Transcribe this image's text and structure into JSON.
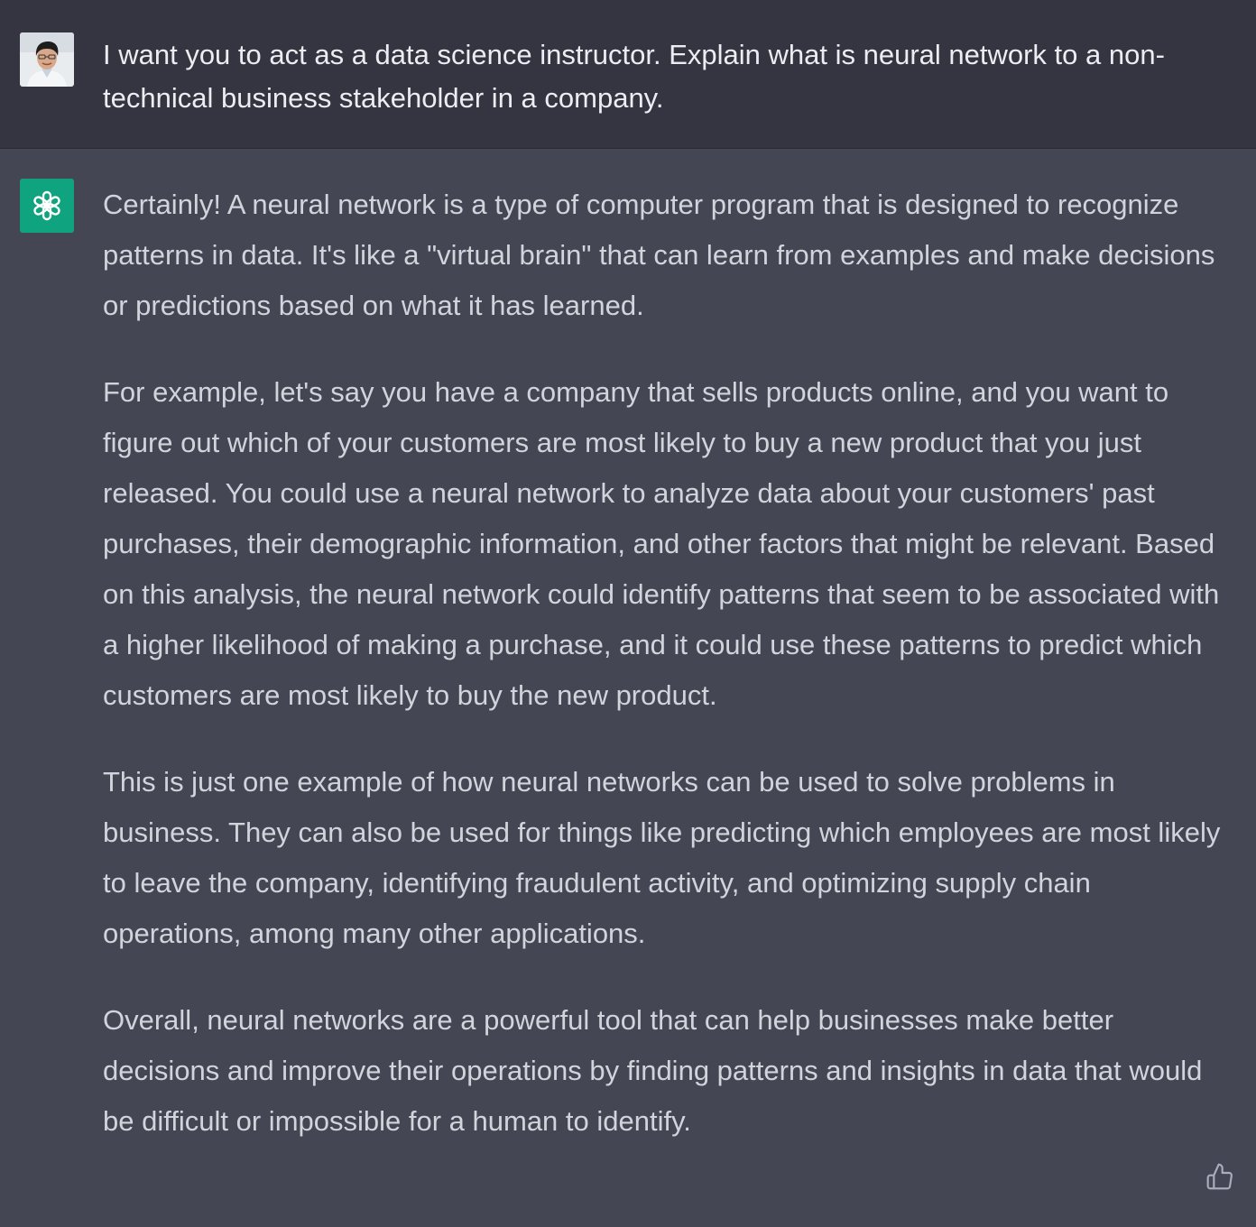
{
  "conversation": {
    "user_message": {
      "avatar_icon": "user-avatar-photo",
      "text": "I want you to act as a data science instructor. Explain what is neural network to a non-technical business stakeholder in a company."
    },
    "assistant_message": {
      "avatar_icon": "openai-logo-icon",
      "accent_color": "#10a37f",
      "paragraphs": [
        "Certainly! A neural network is a type of computer program that is designed to recognize patterns in data. It's like a \"virtual brain\" that can learn from examples and make decisions or predictions based on what it has learned.",
        "For example, let's say you have a company that sells products online, and you want to figure out which of your customers are most likely to buy a new product that you just released. You could use a neural network to analyze data about your customers' past purchases, their demographic information, and other factors that might be relevant. Based on this analysis, the neural network could identify patterns that seem to be associated with a higher likelihood of making a purchase, and it could use these patterns to predict which customers are most likely to buy the new product.",
        "This is just one example of how neural networks can be used to solve problems in business. They can also be used for things like predicting which employees are most likely to leave the company, identifying fraudulent activity, and optimizing supply chain operations, among many other applications.",
        "Overall, neural networks are a powerful tool that can help businesses make better decisions and improve their operations by finding patterns and insights in data that would be difficult or impossible for a human to identify."
      ],
      "feedback_icon": "thumbs-up-icon"
    }
  },
  "colors": {
    "user_bg": "#343541",
    "assistant_bg": "#444654",
    "user_text": "#ececf1",
    "assistant_text": "#d1d5db"
  }
}
